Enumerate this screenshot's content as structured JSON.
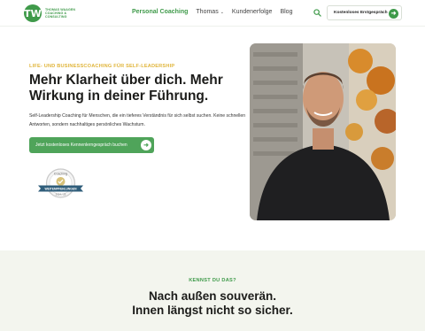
{
  "header": {
    "logo": {
      "mark": "TW",
      "line1": "THOMAS WAAGEN",
      "line2": "COACHING &",
      "line3": "CONSULTING"
    },
    "nav": [
      {
        "label": "Personal Coaching",
        "active": true
      },
      {
        "label": "Thomas",
        "has_dropdown": true
      },
      {
        "label": "Kundenerfolge"
      },
      {
        "label": "Blog"
      }
    ],
    "search_icon": "search-icon",
    "cta_label": "Kostenloses Erstgespräch"
  },
  "hero": {
    "eyebrow": "LIFE- UND BUSINESSCOACHING FÜR SELF-LEADERSHIP",
    "headline": "Mehr Klarheit über dich. Mehr Wirkung in deiner Führung.",
    "subtext": "Self-Leadership Coaching für Menschen, die ein tieferes Verständnis für sich selbst suchen. Keine schnellen Antworten, sondern nachhaltiges persönliches Wachstum.",
    "cta_label": "Jetzt kostenloses Kennenlerngespräch buchen",
    "badge": {
      "top": "Coaching",
      "ribbon": "WEITEMPFEHLUNGEN",
      "bottom": "2024 / 25"
    }
  },
  "section2": {
    "kicker": "KENNST DU DAS?",
    "title_line1": "Nach außen souverän.",
    "title_line2": "Innen längst nicht so sicher."
  },
  "colors": {
    "brand_green": "#3f9a4a",
    "button_green": "#4fa45a",
    "eyebrow_gold": "#e0b53b",
    "section_bg": "#f3f5ee"
  }
}
